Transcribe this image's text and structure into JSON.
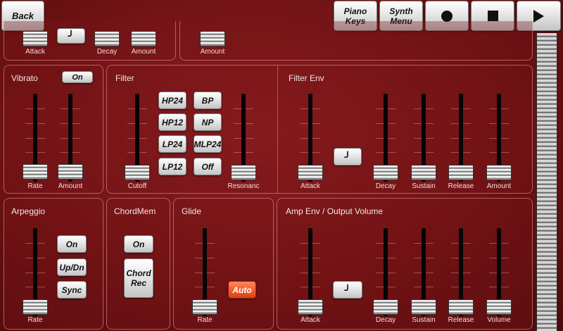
{
  "toolbar": {
    "back_label": "Back",
    "piano_keys_label": "Piano\nKeys",
    "synth_menu_label": "Synth\nMenu",
    "record_icon": "record-icon",
    "stop_icon": "stop-icon",
    "play_icon": "play-icon"
  },
  "top_row": {
    "labels": [
      "Attack",
      "Decay",
      "Amount",
      "Amount"
    ]
  },
  "vibrato": {
    "title": "Vibrato",
    "on_label": "On",
    "sliders": [
      "Rate",
      "Amount"
    ]
  },
  "filter": {
    "title": "Filter",
    "buttons": [
      "HP24",
      "BP",
      "HP12",
      "NP",
      "LP24",
      "MLP24",
      "LP12",
      "Off"
    ],
    "sliders": [
      "Cutoff",
      "Resonanc"
    ]
  },
  "filter_env": {
    "title": "Filter Env",
    "sliders": [
      "Attack",
      "Decay",
      "Sustain",
      "Release",
      "Amount"
    ],
    "curve_icon": "curve-icon"
  },
  "arpeggio": {
    "title": "Arpeggio",
    "slider": "Rate",
    "buttons": [
      "On",
      "Up/Dn",
      "Sync"
    ]
  },
  "chordmem": {
    "title": "ChordMem",
    "on_label": "On",
    "rec_label": "Chord\nRec"
  },
  "glide": {
    "title": "Glide",
    "slider": "Rate",
    "auto_label": "Auto"
  },
  "amp_env": {
    "title": "Amp Env / Output Volume",
    "sliders": [
      "Attack",
      "Decay",
      "Sustain",
      "Release",
      "Volume"
    ],
    "curve_icon": "curve-icon"
  }
}
